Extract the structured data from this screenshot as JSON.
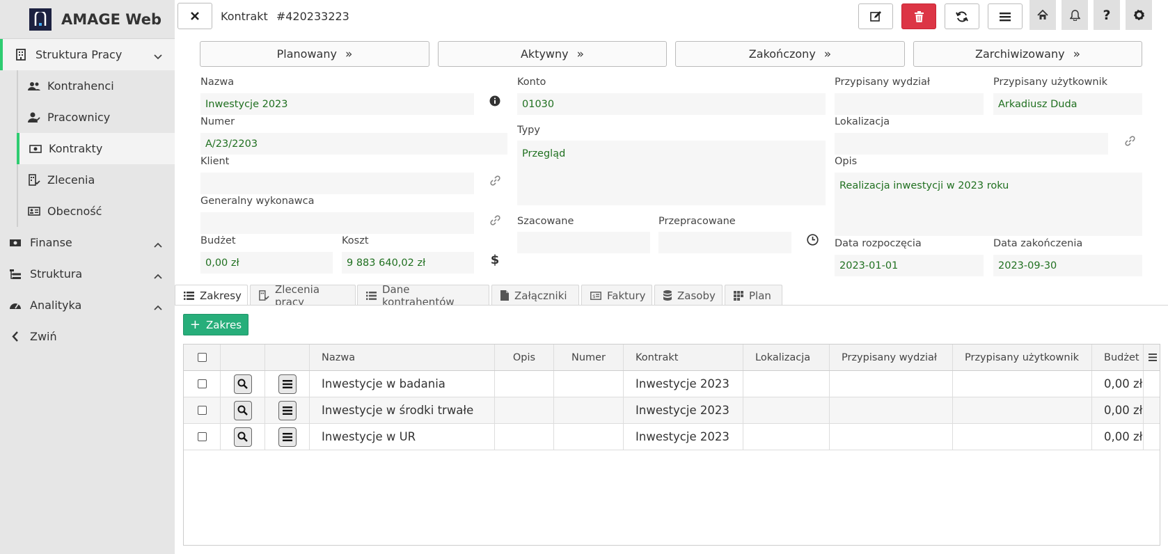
{
  "app": {
    "title": "AMAGE Web"
  },
  "sidebar": {
    "groups": [
      {
        "label": "Struktura Pracy",
        "icon": "building-icon",
        "expanded": true
      },
      {
        "label": "Finanse",
        "icon": "money-icon",
        "expanded": false
      },
      {
        "label": "Struktura",
        "icon": "sitemap-icon",
        "expanded": false
      },
      {
        "label": "Analityka",
        "icon": "gauge-icon",
        "expanded": false
      },
      {
        "label": "Zwiń",
        "icon": "chevron-left-icon"
      }
    ],
    "sub_items": [
      {
        "label": "Kontrahenci",
        "icon": "users-icon"
      },
      {
        "label": "Pracownicy",
        "icon": "user-check-icon"
      },
      {
        "label": "Kontrakty",
        "icon": "banknote-icon",
        "active": true
      },
      {
        "label": "Zlecenia",
        "icon": "building-check-icon"
      },
      {
        "label": "Obecność",
        "icon": "id-card-icon"
      }
    ]
  },
  "header": {
    "entity": "Kontrakt",
    "number": "#420233223"
  },
  "statuses": [
    "Planowany",
    "Aktywny",
    "Zakończony",
    "Zarchiwizowany"
  ],
  "form": {
    "nazwa": {
      "label": "Nazwa",
      "value": "Inwestycje 2023"
    },
    "numer": {
      "label": "Numer",
      "value": "A/23/2203"
    },
    "klient": {
      "label": "Klient",
      "value": ""
    },
    "wykonawca": {
      "label": "Generalny wykonawca",
      "value": ""
    },
    "budzet": {
      "label": "Budżet",
      "value": "0,00 zł"
    },
    "koszt": {
      "label": "Koszt",
      "value": "9 883 640,02 zł"
    },
    "konto": {
      "label": "Konto",
      "value": "01030"
    },
    "typy": {
      "label": "Typy",
      "value": "Przegląd"
    },
    "szacowane": {
      "label": "Szacowane",
      "value": ""
    },
    "przepracowane": {
      "label": "Przepracowane",
      "value": ""
    },
    "wydzial": {
      "label": "Przypisany wydział",
      "value": ""
    },
    "uzytkownik": {
      "label": "Przypisany użytkownik",
      "value": "Arkadiusz Duda"
    },
    "lokalizacja": {
      "label": "Lokalizacja",
      "value": ""
    },
    "opis": {
      "label": "Opis",
      "value": "Realizacja inwestycji w 2023 roku"
    },
    "data_start": {
      "label": "Data rozpoczęcia",
      "value": "2023-01-01"
    },
    "data_end": {
      "label": "Data zakończenia",
      "value": "2023-09-30"
    }
  },
  "tabs": [
    {
      "label": "Zakresy",
      "icon": "list-icon",
      "active": true
    },
    {
      "label": "Zlecenia pracy",
      "icon": "building-check-icon"
    },
    {
      "label": "Dane kontrahentów",
      "icon": "list-icon"
    },
    {
      "label": "Załączniki",
      "icon": "file-icon"
    },
    {
      "label": "Faktury",
      "icon": "invoice-icon"
    },
    {
      "label": "Zasoby",
      "icon": "database-icon"
    },
    {
      "label": "Plan",
      "icon": "grid-icon"
    }
  ],
  "add_button": "Zakres",
  "table": {
    "columns": [
      "Nazwa",
      "Opis",
      "Numer",
      "Kontrakt",
      "Lokalizacja",
      "Przypisany wydział",
      "Przypisany użytkownik",
      "Budżet"
    ],
    "rows": [
      {
        "nazwa": "Inwestycje w badania",
        "opis": "",
        "numer": "",
        "kontrakt": "Inwestycje 2023",
        "lokalizacja": "",
        "wydzial": "",
        "uzytkownik": "",
        "budzet": "0,00 zł"
      },
      {
        "nazwa": "Inwestycje w środki trwałe",
        "opis": "",
        "numer": "",
        "kontrakt": "Inwestycje 2023",
        "lokalizacja": "",
        "wydzial": "",
        "uzytkownik": "",
        "budzet": "0,00 zł"
      },
      {
        "nazwa": "Inwestycje w UR",
        "opis": "",
        "numer": "",
        "kontrakt": "Inwestycje 2023",
        "lokalizacja": "",
        "wydzial": "",
        "uzytkownik": "",
        "budzet": "0,00 zł"
      }
    ]
  },
  "colors": {
    "accent_green": "#2ecc71",
    "delete_red": "#dc3545",
    "add_green": "#27ae7a",
    "value_green": "#207020"
  }
}
